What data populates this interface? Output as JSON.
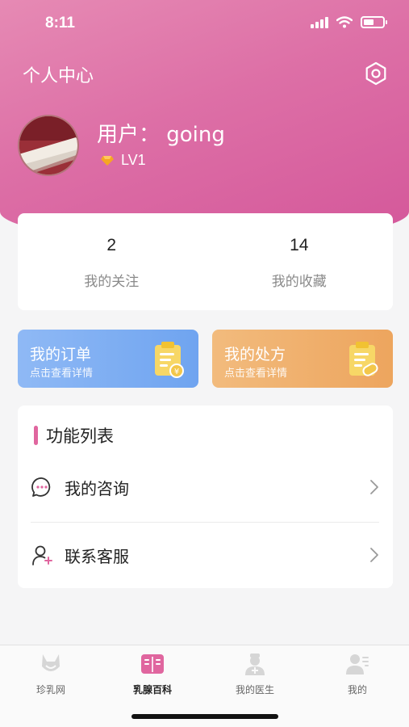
{
  "status_bar": {
    "time": "8:11"
  },
  "header": {
    "title": "个人中心"
  },
  "profile": {
    "username": "用户：  going",
    "level": "LV1"
  },
  "stats": [
    {
      "value": "2",
      "label": "我的关注"
    },
    {
      "value": "14",
      "label": "我的收藏"
    }
  ],
  "quick_actions": [
    {
      "title": "我的订单",
      "subtitle": "点击查看详情"
    },
    {
      "title": "我的处方",
      "subtitle": "点击查看详情"
    }
  ],
  "functions": {
    "title": "功能列表",
    "items": [
      {
        "label": "我的咨询",
        "icon": "chat-bubble-icon"
      },
      {
        "label": "联系客服",
        "icon": "add-user-icon"
      }
    ]
  },
  "tabbar": {
    "items": [
      {
        "label": "珍乳网",
        "icon": "fox-logo-icon"
      },
      {
        "label": "乳腺百科",
        "icon": "book-icon",
        "active": true
      },
      {
        "label": "我的医生",
        "icon": "doctor-icon"
      },
      {
        "label": "我的",
        "icon": "profile-icon"
      }
    ]
  },
  "colors": {
    "header_gradient_start": "#e68ab4",
    "header_gradient_end": "#d4579a",
    "accent": "#e0669f",
    "orders_card": "#6fa4f0",
    "prescription_card": "#eda55e"
  }
}
